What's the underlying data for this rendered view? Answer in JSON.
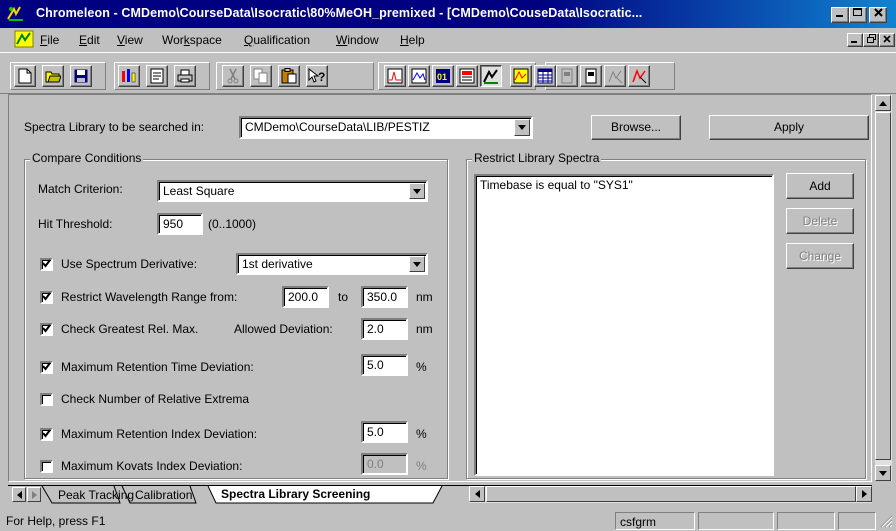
{
  "window": {
    "title": "Chromeleon - CMDemo\\CourseData\\Isocratic\\80%MeOH_premixed - [CMDemo\\CouseData\\Isocratic..."
  },
  "menu": [
    "File",
    "Edit",
    "View",
    "Workspace",
    "Qualification",
    "Window",
    "Help"
  ],
  "search": {
    "label": "Spectra Library to be searched in:",
    "library": "CMDemo\\CourseData\\LIB/PESTIZ",
    "browse_label": "Browse...",
    "apply_label": "Apply"
  },
  "compare": {
    "group_title": "Compare Conditions",
    "match_label": "Match Criterion:",
    "match_value": "Least Square",
    "hit_label": "Hit Threshold:",
    "hit_value": "950",
    "hit_range": "(0..1000)",
    "derivative_label": "Use Spectrum Derivative:",
    "derivative_value": "1st derivative",
    "wavelength_label": "Restrict Wavelength Range from:",
    "wavelength_from": "200.0",
    "wavelength_to_label": "to",
    "wavelength_to": "350.0",
    "wavelength_unit": "nm",
    "greatest_label": "Check Greatest Rel. Max.",
    "deviation_label": "Allowed Deviation:",
    "deviation_value": "2.0",
    "deviation_unit": "nm",
    "retention_time_label": "Maximum Retention Time Deviation:",
    "retention_time_value": "5.0",
    "retention_time_unit": "%",
    "extrema_label": "Check Number of Relative Extrema",
    "retention_index_label": "Maximum Retention Index Deviation:",
    "retention_index_value": "5.0",
    "retention_index_unit": "%",
    "kovats_label": "Maximum Kovats Index Deviation:",
    "kovats_value": "0.0",
    "kovats_unit": "%",
    "checks": {
      "derivative": true,
      "wavelength": true,
      "greatest": true,
      "retention_time": true,
      "extrema": false,
      "retention_index": true,
      "kovats": false
    }
  },
  "restrict": {
    "group_title": "Restrict Library Spectra",
    "items": [
      "Timebase is equal to \"SYS1\""
    ],
    "add_label": "Add",
    "delete_label": "Delete",
    "change_label": "Change"
  },
  "tabs": [
    "Peak Tracking",
    "Calibration",
    "Spectra Library Screening"
  ],
  "status": {
    "help": "For Help, press F1",
    "user": "csfgrm"
  }
}
